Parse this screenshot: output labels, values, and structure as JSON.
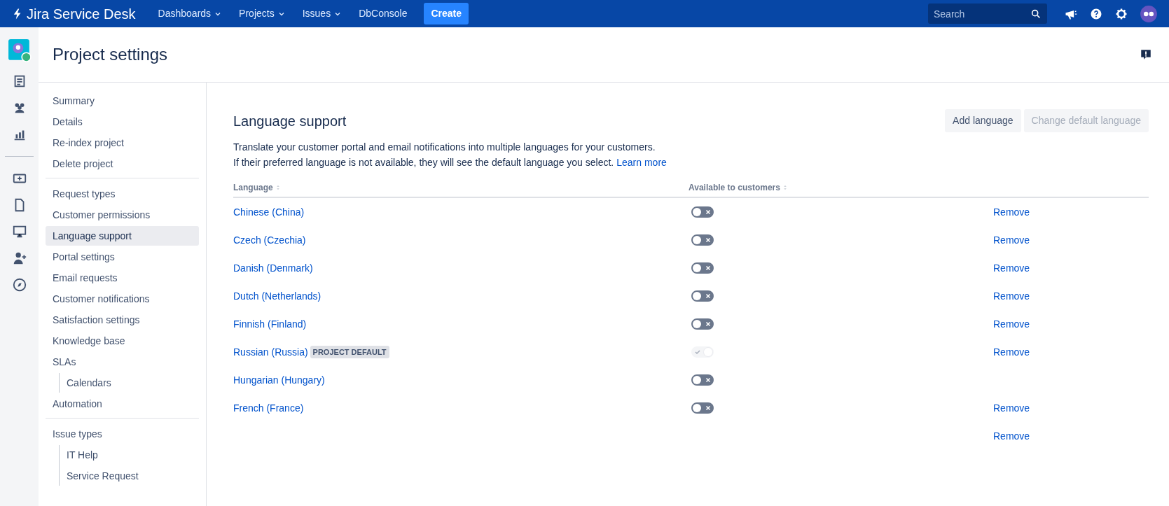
{
  "topbar": {
    "product": "Jira Service Desk",
    "menus": [
      {
        "label": "Dashboards",
        "dropdown": true
      },
      {
        "label": "Projects",
        "dropdown": true
      },
      {
        "label": "Issues",
        "dropdown": true
      },
      {
        "label": "DbConsole",
        "dropdown": false
      }
    ],
    "create": "Create",
    "search": {
      "placeholder": "Search"
    }
  },
  "page": {
    "title": "Project settings"
  },
  "sidebar": {
    "groups": [
      [
        {
          "label": "Summary",
          "selected": false
        },
        {
          "label": "Details",
          "selected": false
        },
        {
          "label": "Re-index project",
          "selected": false
        },
        {
          "label": "Delete project",
          "selected": false
        }
      ],
      [
        {
          "label": "Request types",
          "selected": false
        },
        {
          "label": "Customer permissions",
          "selected": false
        },
        {
          "label": "Language support",
          "selected": true
        },
        {
          "label": "Portal settings",
          "selected": false
        },
        {
          "label": "Email requests",
          "selected": false
        },
        {
          "label": "Customer notifications",
          "selected": false
        },
        {
          "label": "Satisfaction settings",
          "selected": false
        },
        {
          "label": "Knowledge base",
          "selected": false
        },
        {
          "label": "SLAs",
          "selected": false,
          "children": [
            {
              "label": "Calendars",
              "selected": false
            }
          ]
        },
        {
          "label": "Automation",
          "selected": false
        }
      ],
      [
        {
          "label": "Issue types",
          "selected": false,
          "children": [
            {
              "label": "IT Help",
              "selected": false
            },
            {
              "label": "Service Request",
              "selected": false
            }
          ]
        }
      ]
    ]
  },
  "section": {
    "title": "Language support",
    "buttons": [
      {
        "label": "Add language",
        "disabled": false
      },
      {
        "label": "Change default language",
        "disabled": true
      }
    ],
    "description": [
      "Translate your customer portal and email notifications into multiple languages for your customers.",
      "If their preferred language is not available, they will see the default language you select."
    ],
    "learn_more": "Learn more"
  },
  "table": {
    "columns": [
      "Language",
      "Available to customers"
    ],
    "rows": [
      {
        "language": "Chinese (China)",
        "available": false,
        "disabled": false,
        "remove": "Remove"
      },
      {
        "language": "Czech (Czechia)",
        "available": false,
        "disabled": false,
        "remove": "Remove"
      },
      {
        "language": "Danish (Denmark)",
        "available": false,
        "disabled": false,
        "remove": "Remove"
      },
      {
        "language": "Dutch (Netherlands)",
        "available": false,
        "disabled": false,
        "remove": "Remove"
      },
      {
        "language": "Finnish (Finland)",
        "available": false,
        "disabled": false,
        "remove": "Remove"
      },
      {
        "language": "Russian (Russia)",
        "badge": "PROJECT DEFAULT",
        "available": true,
        "disabled": true,
        "remove": "Remove"
      },
      {
        "language": "Hungarian (Hungary)",
        "available": false,
        "disabled": false
      },
      {
        "language": "French (France)",
        "available": false,
        "disabled": false,
        "remove": "Remove"
      },
      {
        "remove": "Remove"
      }
    ]
  }
}
